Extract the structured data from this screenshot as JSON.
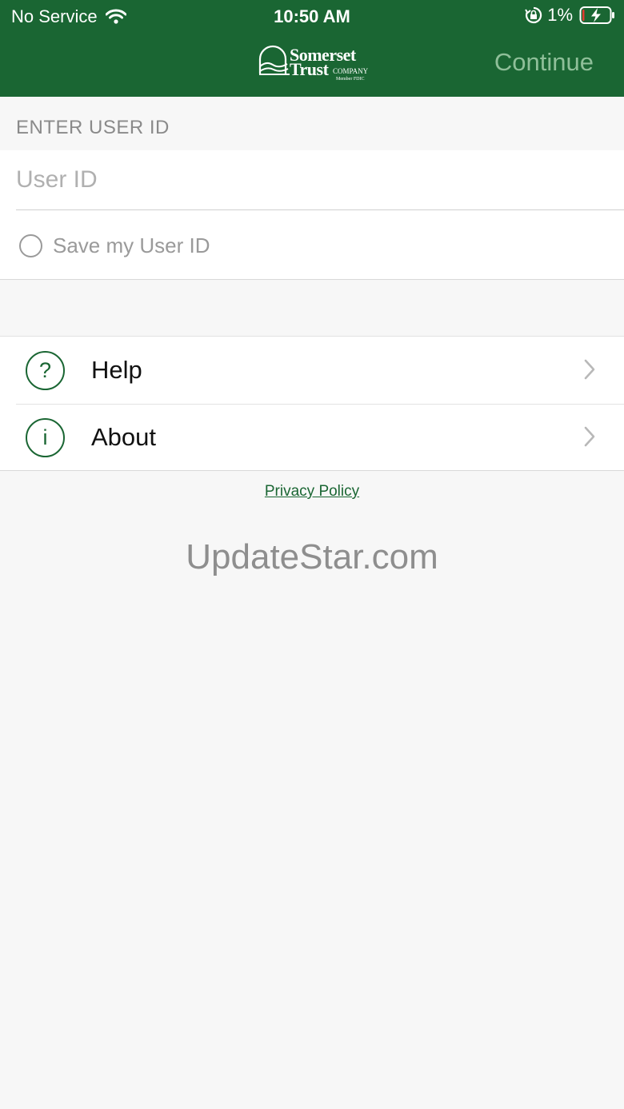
{
  "status_bar": {
    "carrier": "No Service",
    "time": "10:50 AM",
    "battery_pct": "1%"
  },
  "header": {
    "logo_line1": "Somerset",
    "logo_line2": "Trust",
    "logo_company": "COMPANY",
    "logo_fdic": "Member FDIC",
    "continue_label": "Continue"
  },
  "login": {
    "section_label": "ENTER USER ID",
    "user_id_placeholder": "User ID",
    "save_label": "Save my User ID"
  },
  "menu": {
    "items": [
      {
        "label": "Help",
        "icon": "question-icon",
        "glyph": "?"
      },
      {
        "label": "About",
        "icon": "info-icon",
        "glyph": "i"
      }
    ]
  },
  "footer": {
    "privacy_label": "Privacy Policy",
    "watermark": "UpdateStar.com"
  },
  "colors": {
    "brand_green": "#1a6633",
    "continue_disabled": "#8fbf99",
    "background": "#f7f7f7"
  }
}
